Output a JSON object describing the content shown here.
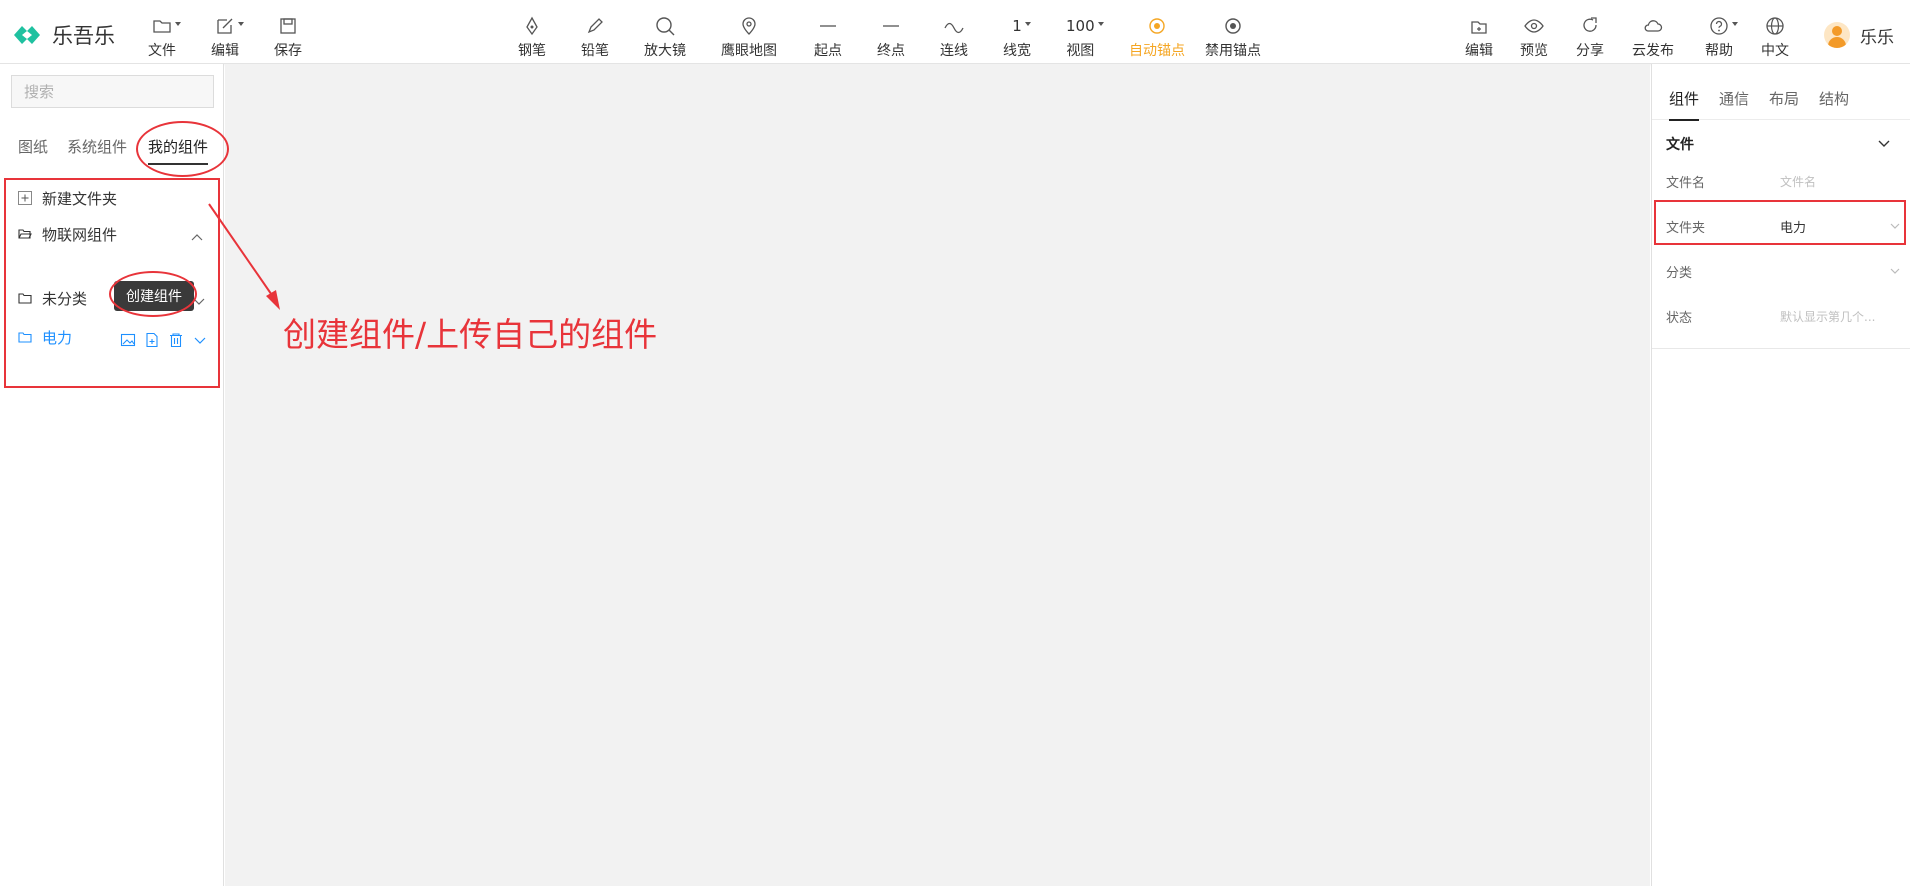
{
  "app": {
    "name": "乐吾乐",
    "brand_color": "#1fc1a0"
  },
  "toolbar_left": [
    {
      "label": "文件",
      "icon": "folder-icon",
      "has_menu": true
    },
    {
      "label": "编辑",
      "icon": "edit-icon",
      "has_menu": true
    },
    {
      "label": "保存",
      "icon": "save-icon",
      "has_menu": false
    }
  ],
  "toolbar_center": [
    {
      "label": "钢笔",
      "icon": "pen-icon"
    },
    {
      "label": "铅笔",
      "icon": "pencil-icon"
    },
    {
      "label": "放大镜",
      "icon": "magnifier-icon"
    },
    {
      "label": "鹰眼地图",
      "icon": "map-pin-icon"
    },
    {
      "label": "起点",
      "icon": "line-start-icon"
    },
    {
      "label": "终点",
      "icon": "line-end-icon"
    },
    {
      "label": "连线",
      "icon": "curve-icon"
    },
    {
      "label": "线宽",
      "value": "1",
      "has_menu": true
    },
    {
      "label": "视图",
      "value": "100",
      "has_menu": true
    },
    {
      "label": "自动锚点",
      "icon": "anchor-auto-icon",
      "active": true
    },
    {
      "label": "禁用锚点",
      "icon": "anchor-disabled-icon"
    }
  ],
  "toolbar_right": [
    {
      "label": "编辑",
      "icon": "edit-mode-icon"
    },
    {
      "label": "预览",
      "icon": "eye-icon"
    },
    {
      "label": "分享",
      "icon": "share-icon"
    },
    {
      "label": "云发布",
      "icon": "cloud-icon"
    },
    {
      "label": "帮助",
      "icon": "help-icon",
      "has_menu": true
    },
    {
      "label": "中文",
      "icon": "globe-icon"
    }
  ],
  "user": {
    "name": "乐乐"
  },
  "left_panel": {
    "search_placeholder": "搜索",
    "tabs": [
      {
        "label": "图纸",
        "active": false
      },
      {
        "label": "系统组件",
        "active": false
      },
      {
        "label": "我的组件",
        "active": true
      }
    ],
    "new_folder_label": "新建文件夹",
    "folders": [
      {
        "label": "物联网组件",
        "expanded": true
      },
      {
        "label": "未分类"
      },
      {
        "label": "电力",
        "selected": true
      }
    ],
    "tooltip": "创建组件"
  },
  "right_panel": {
    "tabs": [
      {
        "label": "组件",
        "active": true
      },
      {
        "label": "通信",
        "active": false
      },
      {
        "label": "布局",
        "active": false
      },
      {
        "label": "结构",
        "active": false
      }
    ],
    "section_title": "文件",
    "fields": {
      "filename": {
        "label": "文件名",
        "placeholder": "文件名"
      },
      "folder": {
        "label": "文件夹",
        "value": "电力"
      },
      "category": {
        "label": "分类",
        "value": ""
      },
      "status": {
        "label": "状态",
        "placeholder": "默认显示第几个..."
      }
    }
  },
  "annotation": {
    "text": "创建组件/上传自己的组件",
    "color": "#e8343a"
  },
  "colors": {
    "accent": "#f5a623",
    "selected": "#1e90ff",
    "canvas": "#f2f2f2"
  }
}
